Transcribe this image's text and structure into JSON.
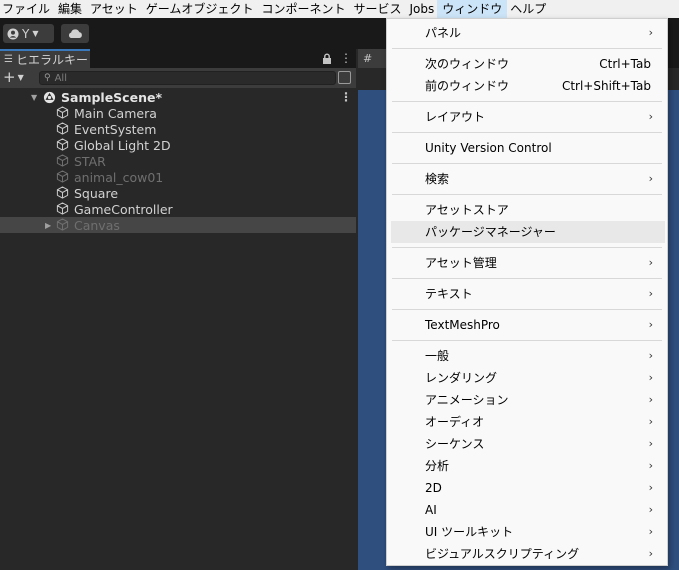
{
  "menubar": {
    "items": [
      "ファイル",
      "編集",
      "アセット",
      "ゲームオブジェクト",
      "コンポーネント",
      "サービス",
      "Jobs",
      "ウィンドウ",
      "ヘルプ"
    ],
    "active_index": 7
  },
  "toolbar": {
    "account_label": "Y",
    "account_icon": "account-icon",
    "cloud_icon": "cloud-icon"
  },
  "hierarchy": {
    "tab_label": "ヒエラルキー",
    "add_label": "+",
    "search_placeholder": "All",
    "scene_name": "SampleScene*",
    "objects": [
      {
        "label": "Main Camera",
        "active": true
      },
      {
        "label": "EventSystem",
        "active": true
      },
      {
        "label": "Global Light 2D",
        "active": true
      },
      {
        "label": "STAR",
        "active": false
      },
      {
        "label": "animal_cow01",
        "active": false
      },
      {
        "label": "Square",
        "active": true
      },
      {
        "label": "GameController",
        "active": true
      },
      {
        "label": "Canvas",
        "active": false,
        "has_children": true,
        "selected": true
      }
    ]
  },
  "scene": {
    "tab_label": "#"
  },
  "window_menu": {
    "items": [
      {
        "label": "パネル",
        "submenu": true
      },
      {
        "separator": true
      },
      {
        "label": "次のウィンドウ",
        "shortcut": "Ctrl+Tab"
      },
      {
        "label": "前のウィンドウ",
        "shortcut": "Ctrl+Shift+Tab"
      },
      {
        "separator": true
      },
      {
        "label": "レイアウト",
        "submenu": true
      },
      {
        "separator": true
      },
      {
        "label": "Unity Version Control"
      },
      {
        "separator": true
      },
      {
        "label": "検索",
        "submenu": true
      },
      {
        "separator": true
      },
      {
        "label": "アセットストア"
      },
      {
        "label": "パッケージマネージャー",
        "hovered": true
      },
      {
        "separator": true
      },
      {
        "label": "アセット管理",
        "submenu": true
      },
      {
        "separator": true
      },
      {
        "label": "テキスト",
        "submenu": true
      },
      {
        "separator": true
      },
      {
        "label": "TextMeshPro",
        "submenu": true
      },
      {
        "separator": true
      },
      {
        "label": "一般",
        "submenu": true
      },
      {
        "label": "レンダリング",
        "submenu": true
      },
      {
        "label": "アニメーション",
        "submenu": true
      },
      {
        "label": "オーディオ",
        "submenu": true
      },
      {
        "label": "シーケンス",
        "submenu": true
      },
      {
        "label": "分析",
        "submenu": true
      },
      {
        "label": "2D",
        "submenu": true
      },
      {
        "label": "AI",
        "submenu": true
      },
      {
        "label": "UI ツールキット",
        "submenu": true
      },
      {
        "label": "ビジュアルスクリプティング",
        "submenu": true
      }
    ],
    "arrow_glyph": "›"
  },
  "colors": {
    "accent": "#3a79bb",
    "scene_background": "#2f4f7f",
    "menu_highlight": "#cce4f7"
  }
}
